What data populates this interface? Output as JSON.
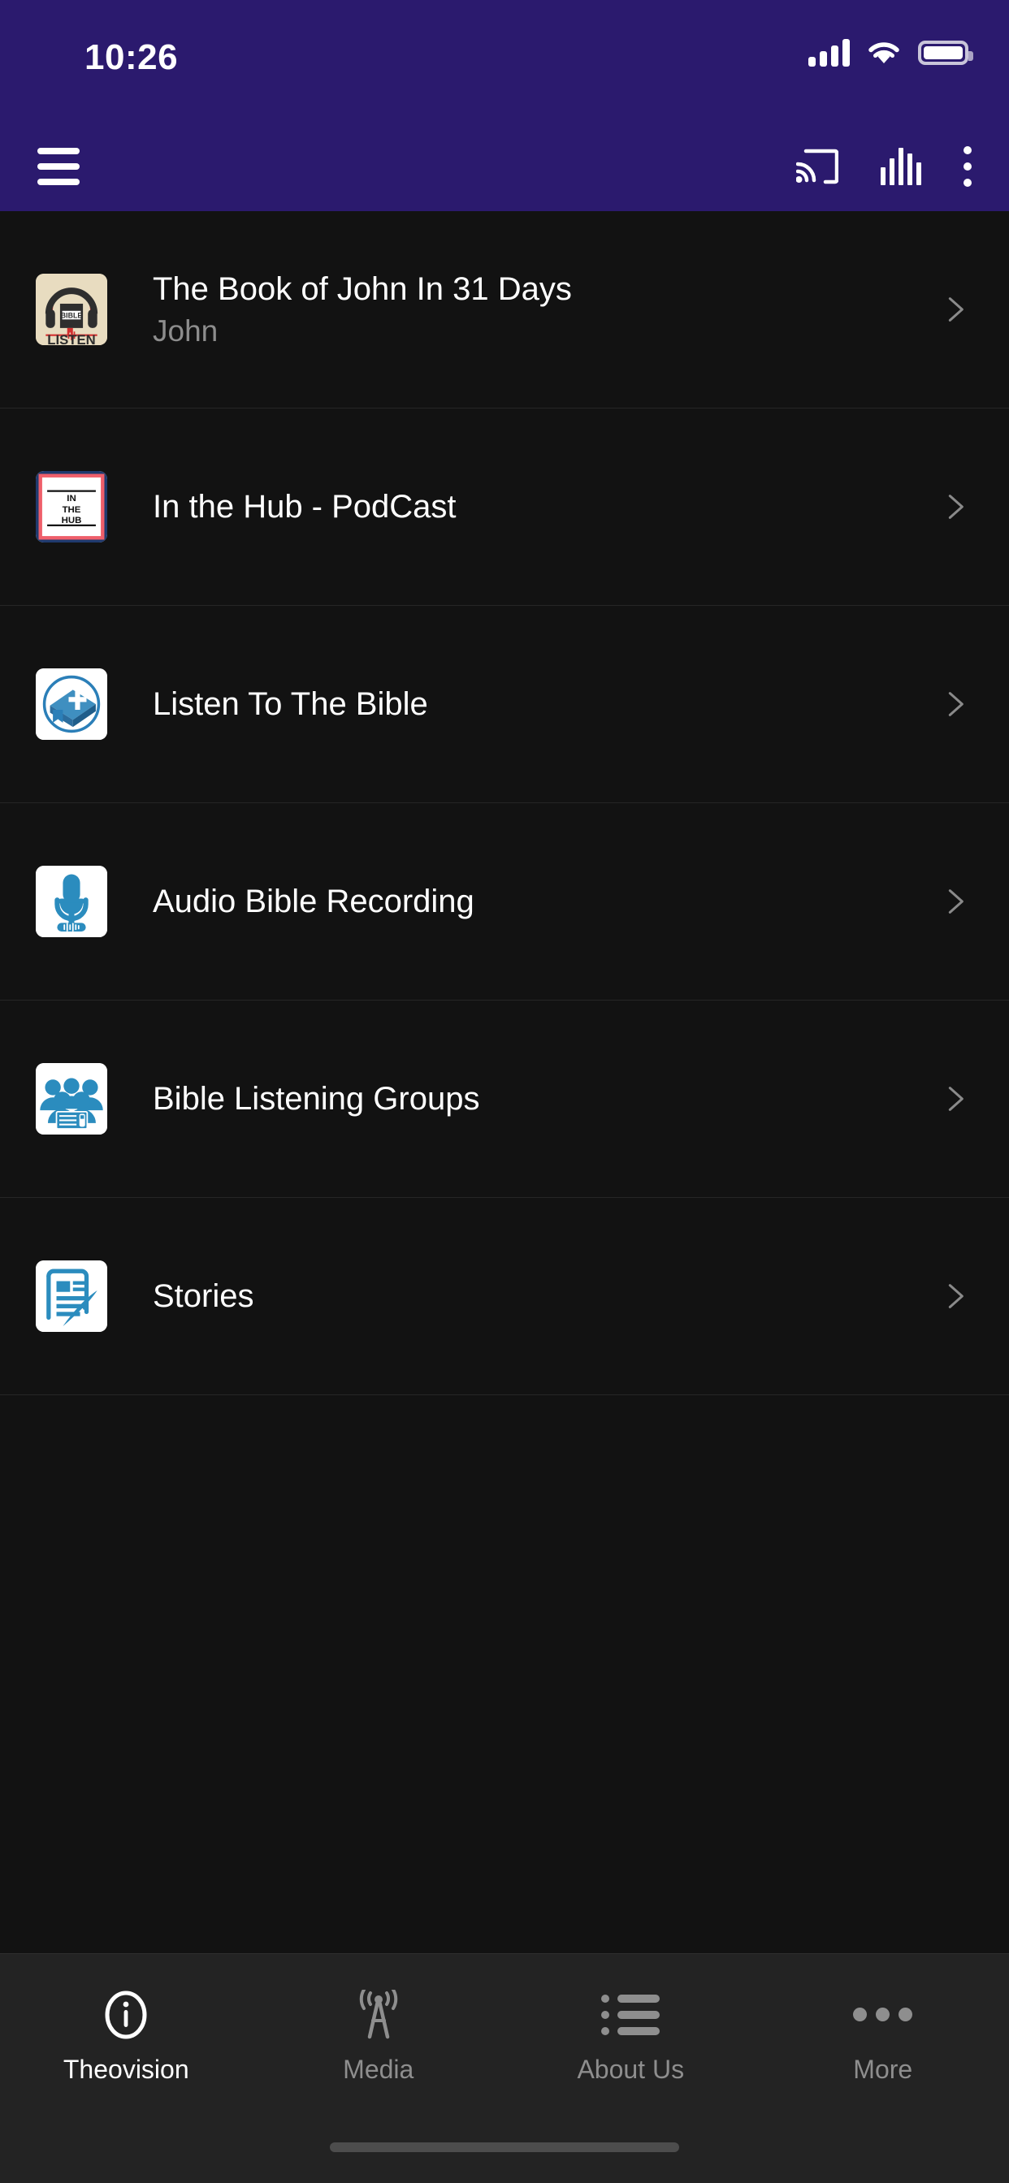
{
  "status_bar": {
    "time": "10:26",
    "signal_icon": "cellular-signal-icon",
    "wifi_icon": "wifi-icon",
    "battery_icon": "battery-full-icon",
    "background_color": "#2B1A6E"
  },
  "app_bar": {
    "menu_icon": "hamburger-menu-icon",
    "cast_icon": "chromecast-icon",
    "equalizer_icon": "audio-equalizer-icon",
    "overflow_icon": "more-vertical-icon",
    "background_color": "#2B1A6E"
  },
  "list": {
    "chevron_icon": "chevron-right-icon",
    "items": [
      {
        "title": "The Book of John In 31 Days",
        "subtitle": "John",
        "thumbnail": "bible-listen-logo",
        "thumb_bg": "#E8DCC0"
      },
      {
        "title": "In the Hub - PodCast",
        "subtitle": "",
        "thumbnail": "in-the-hub-logo",
        "thumb_bg": "#FFFFFF"
      },
      {
        "title": "Listen To The Bible",
        "subtitle": "",
        "thumbnail": "bible-circle-logo",
        "thumb_bg": "#FFFFFF"
      },
      {
        "title": "Audio Bible Recording",
        "subtitle": "",
        "thumbnail": "microphone-logo",
        "thumb_bg": "#FFFFFF"
      },
      {
        "title": "Bible Listening Groups",
        "subtitle": "",
        "thumbnail": "people-group-logo",
        "thumb_bg": "#FFFFFF"
      },
      {
        "title": "Stories",
        "subtitle": "",
        "thumbnail": "article-pen-logo",
        "thumb_bg": "#FFFFFF"
      }
    ]
  },
  "tab_bar": {
    "tabs": [
      {
        "label": "Theovision",
        "icon": "info-circle-icon",
        "active": true
      },
      {
        "label": "Media",
        "icon": "broadcast-tower-icon",
        "active": false
      },
      {
        "label": "About Us",
        "icon": "bulleted-list-icon",
        "active": false
      },
      {
        "label": "More",
        "icon": "more-horizontal-icon",
        "active": false
      }
    ],
    "background_color": "#232323",
    "active_color": "#FFFFFF",
    "inactive_color": "#8E8E8E"
  },
  "theme": {
    "page_background": "#121212",
    "brand_purple": "#2B1A6E",
    "icon_blue": "#2B8CBE",
    "divider": "#262626"
  }
}
